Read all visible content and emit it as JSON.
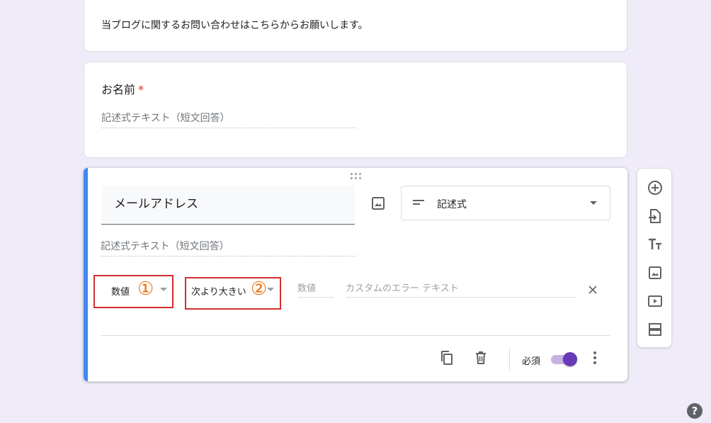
{
  "form": {
    "description": "当ブログに関するお問い合わせはこちらからお願いします。"
  },
  "name_question": {
    "title": "お名前",
    "required_mark": "*",
    "answer_placeholder": "記述式テキスト（短文回答）"
  },
  "email_question": {
    "title": "メールアドレス",
    "type_label": "記述式",
    "answer_placeholder": "記述式テキスト（短文回答）",
    "validation": {
      "category": "数値",
      "condition": "次より大きい",
      "value_placeholder": "数値",
      "error_placeholder": "カスタムのエラー テキスト"
    },
    "annotations": {
      "one": "①",
      "two": "②"
    },
    "required_label": "必須",
    "required_on": true
  },
  "help": {
    "label": "?"
  },
  "colors": {
    "accent": "#4285f4",
    "toggle": "#673ab7",
    "annotation_box": "#d32f2f",
    "annotation_number": "#ef6c00",
    "background": "#f0ebf8"
  },
  "icons": {
    "toolbar": [
      "add-question-icon",
      "import-questions-icon",
      "add-title-icon",
      "add-image-icon",
      "add-video-icon",
      "add-section-icon"
    ],
    "footer": [
      "duplicate-icon",
      "delete-icon",
      "more-vert-icon"
    ]
  }
}
